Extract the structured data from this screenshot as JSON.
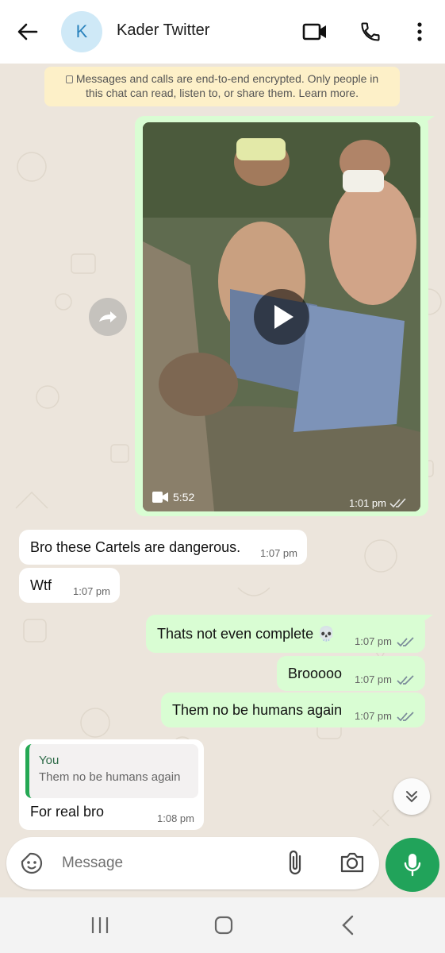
{
  "header": {
    "contact_name": "Kader Twitter",
    "avatar_initial": "K",
    "icons": [
      "back-arrow-icon",
      "video-call-icon",
      "phone-icon",
      "more-icon"
    ]
  },
  "encryption_notice": {
    "line1": "Messages and calls are end-to-end encrypted. Only people in",
    "line2": "this chat can read, listen to, or share them. Learn more."
  },
  "video_message": {
    "duration": "5:52",
    "time": "1:01 pm",
    "status": "read"
  },
  "messages": [
    {
      "direction": "in",
      "text": "Bro these Cartels are dangerous.",
      "time": "1:07 pm"
    },
    {
      "direction": "in",
      "text": "Wtf",
      "time": "1:07 pm"
    },
    {
      "direction": "out",
      "text": "Thats not even complete 💀",
      "time": "1:07 pm",
      "status": "read"
    },
    {
      "direction": "out",
      "text": "Brooooo",
      "time": "1:07 pm",
      "status": "read"
    },
    {
      "direction": "out",
      "text": "Them no be humans again",
      "time": "1:07 pm",
      "status": "read"
    },
    {
      "direction": "in",
      "text": "For real bro",
      "time": "1:08 pm",
      "reply_to": {
        "author": "You",
        "text": "Them no be humans again"
      }
    }
  ],
  "composer": {
    "placeholder": "Message"
  },
  "colors": {
    "accent_green": "#21a35a",
    "outgoing_bubble": "#d9fdd3",
    "tick_read": "#7a8a99"
  }
}
